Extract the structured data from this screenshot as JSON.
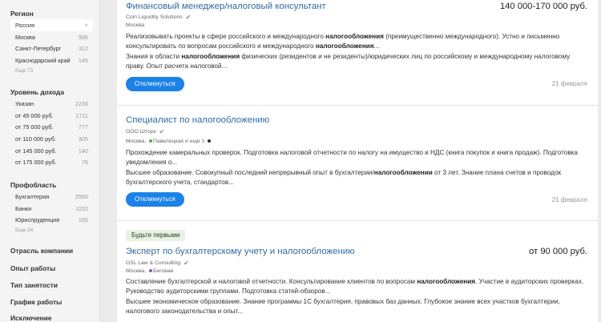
{
  "sidebar": {
    "region": {
      "title": "Регион",
      "selected": {
        "label": "Россия",
        "close": "×"
      },
      "items": [
        {
          "label": "Москва",
          "count": "906"
        },
        {
          "label": "Санкт-Петербург",
          "count": "312"
        },
        {
          "label": "Краснодарский край",
          "count": "145"
        }
      ],
      "more": "Еще 73"
    },
    "income": {
      "title": "Уровень дохода",
      "items": [
        {
          "label": "Указан",
          "count": "2236"
        },
        {
          "label": "от 45 000 руб.",
          "count": "1711"
        },
        {
          "label": "от 75 000 руб.",
          "count": "777"
        },
        {
          "label": "от 110 000 руб.",
          "count": "305"
        },
        {
          "label": "от 145 000 руб.",
          "count": "140"
        },
        {
          "label": "от 175 000 руб.",
          "count": "76"
        }
      ]
    },
    "profarea": {
      "title": "Профобласть",
      "items": [
        {
          "label": "Бухгалтерия",
          "count": "2560"
        },
        {
          "label": "Банки",
          "count": "1152"
        },
        {
          "label": "Юриспруденция",
          "count": "195"
        }
      ],
      "more": "Еще 24"
    },
    "collapsed": [
      "Отрасль компании",
      "Опыт работы",
      "Тип занятости",
      "График работы",
      "Исключение"
    ]
  },
  "vacancies": [
    {
      "title": "Финансовый менеджер/налоговый консультант",
      "salary": "140 000-170 000 руб.",
      "company": "Coin Liquidity Solutions",
      "location": "Москва",
      "resp": [
        "Реализовывать проекты в сфере российского и международного ",
        "налогообложения",
        " (преимущественно международного). Устно и письменно консультировать по вопросам российского и международного ",
        "налогообложения",
        "..."
      ],
      "req": [
        "Знания в области ",
        "налогообложения",
        " физических (резидентов и не резиденты)/юридических лиц по российскому и международному налоговому праву. Опыт расчета налоговой..."
      ],
      "button": "Откликнуться",
      "date": "21 февраля"
    },
    {
      "title": "Специалист по налогообложению",
      "company": "ООО Шторк",
      "location": "Москва,",
      "metro": "Павелецкая и еще 1",
      "metro_color": "#4caf50",
      "metro_color2": "#333333",
      "resp": [
        "Прохождение камеральных проверок. Подготовка налоговой отчетности по налогу на имущество и НДС (книга покупок и книга продаж). Подготовка уведомления о..."
      ],
      "req": [
        "Высшее образование. Совокупный последний непрерывный опыт в бухгалтерии/",
        "налогообложении",
        " от 3 лет. Знание плана счетов и проводок бухгалтерского учета, стандартов..."
      ],
      "button": "Откликнуться",
      "date": "21 февраля"
    },
    {
      "badge": "Будьте первыми",
      "title": "Эксперт по бухгалтерскому учету и налогообложению",
      "salary": "от 90 000 руб.",
      "company": "GSL Law & Consulting",
      "location": "Москва,",
      "metro": "Беговая",
      "metro_color": "#8e5ea2",
      "resp": [
        "Составление бухгалтерской и налоговой отчетности. Консультирование клиентов по вопросам ",
        "налогообложения",
        ". Участие в аудиторских проверках. Руководство аудиторскими группами. Подготовка статей-обзоров..."
      ],
      "req": [
        "Высшее экономическое образование. Знание программы 1С бухгалтерия, правовых баз данных. Глубокое знание всех участков бухгалтерии, налогового законодательства и опыт..."
      ]
    }
  ]
}
